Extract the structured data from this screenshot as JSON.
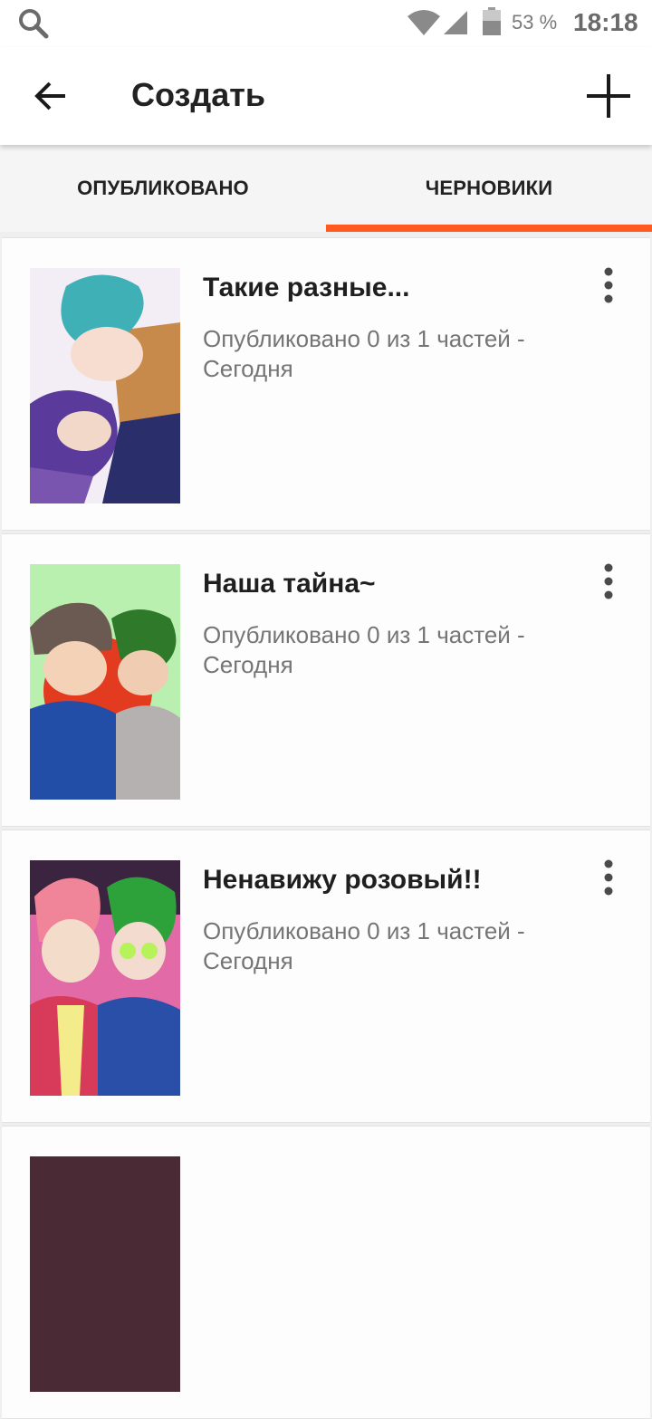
{
  "status_bar": {
    "battery_percent": "53 %",
    "time": "18:18",
    "icons": [
      "search-icon",
      "wifi-icon",
      "signal-icon",
      "battery-icon"
    ]
  },
  "header": {
    "title": "Создать",
    "back_icon": "arrow-left-icon",
    "add_icon": "plus-icon"
  },
  "tabs": [
    {
      "label": "ОПУБЛИКОВАНО",
      "active": false
    },
    {
      "label": "ЧЕРНОВИКИ",
      "active": true
    }
  ],
  "accent_color": "#ff5a1f",
  "stories": [
    {
      "title": "Такие разные...",
      "meta_line1": "Опубликовано 0 из 1 частей -",
      "meta_line2": "Сегодня"
    },
    {
      "title": "Наша тайна~",
      "meta_line1": "Опубликовано 0 из 1 частей -",
      "meta_line2": "Сегодня"
    },
    {
      "title": "Ненавижу розовый!!",
      "meta_line1": "Опубликовано 0 из 1 частей -",
      "meta_line2": "Сегодня"
    }
  ]
}
